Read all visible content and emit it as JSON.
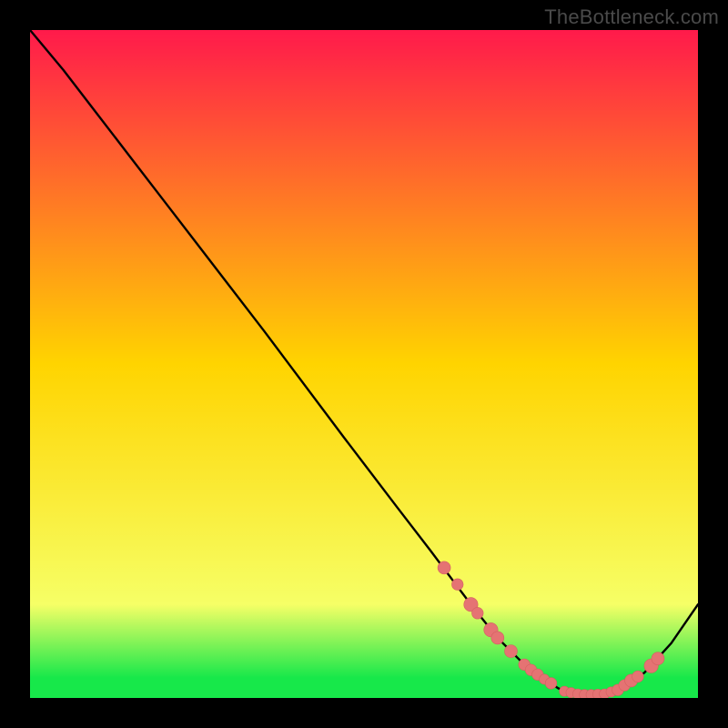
{
  "watermark": "TheBottleneck.com",
  "colors": {
    "background": "#000000",
    "gradient_top": "#ff1a4b",
    "gradient_mid": "#ffd400",
    "gradient_edge": "#f6ff66",
    "gradient_green": "#17e84a",
    "curve": "#000000",
    "marker_fill": "#e57373",
    "marker_stroke": "#d46060"
  },
  "chart_data": {
    "type": "line",
    "x": [
      0,
      5,
      10,
      15,
      20,
      25,
      30,
      35,
      38,
      47,
      55,
      60,
      66,
      68,
      70,
      72,
      74,
      76,
      78,
      79,
      80,
      82,
      84,
      86,
      88,
      92,
      96,
      100
    ],
    "y": [
      100,
      94,
      87.5,
      81,
      74.5,
      68,
      61.5,
      55,
      51,
      39,
      28.5,
      22,
      14,
      11.5,
      9,
      7,
      5,
      3.5,
      2.2,
      1.5,
      1,
      0.6,
      0.5,
      0.6,
      1.2,
      3.8,
      8.2,
      14
    ],
    "xlim": [
      0,
      100
    ],
    "ylim": [
      0,
      100
    ],
    "grid": false,
    "legend": false,
    "markers": [
      {
        "x": 62,
        "y": 19.5,
        "r": 1.0
      },
      {
        "x": 64,
        "y": 17,
        "r": 0.9
      },
      {
        "x": 66,
        "y": 14,
        "r": 1.1
      },
      {
        "x": 67,
        "y": 12.7,
        "r": 0.9
      },
      {
        "x": 69,
        "y": 10.2,
        "r": 1.1
      },
      {
        "x": 70,
        "y": 9,
        "r": 1.0
      },
      {
        "x": 72,
        "y": 7,
        "r": 1.0
      },
      {
        "x": 74,
        "y": 5,
        "r": 0.9
      },
      {
        "x": 75,
        "y": 4.2,
        "r": 0.9
      },
      {
        "x": 76,
        "y": 3.5,
        "r": 0.9
      },
      {
        "x": 77,
        "y": 2.8,
        "r": 0.8
      },
      {
        "x": 78,
        "y": 2.2,
        "r": 0.9
      },
      {
        "x": 80,
        "y": 1,
        "r": 0.8
      },
      {
        "x": 81,
        "y": 0.8,
        "r": 0.8
      },
      {
        "x": 82,
        "y": 0.6,
        "r": 0.8
      },
      {
        "x": 83,
        "y": 0.5,
        "r": 0.8
      },
      {
        "x": 84,
        "y": 0.5,
        "r": 0.8
      },
      {
        "x": 85,
        "y": 0.55,
        "r": 0.8
      },
      {
        "x": 86,
        "y": 0.6,
        "r": 0.8
      },
      {
        "x": 87,
        "y": 0.9,
        "r": 0.8
      },
      {
        "x": 88,
        "y": 1.2,
        "r": 0.9
      },
      {
        "x": 89,
        "y": 1.9,
        "r": 0.9
      },
      {
        "x": 90,
        "y": 2.6,
        "r": 1.0
      },
      {
        "x": 91,
        "y": 3.2,
        "r": 0.9
      },
      {
        "x": 93,
        "y": 4.8,
        "r": 1.1
      },
      {
        "x": 94,
        "y": 5.9,
        "r": 1.0
      }
    ]
  }
}
